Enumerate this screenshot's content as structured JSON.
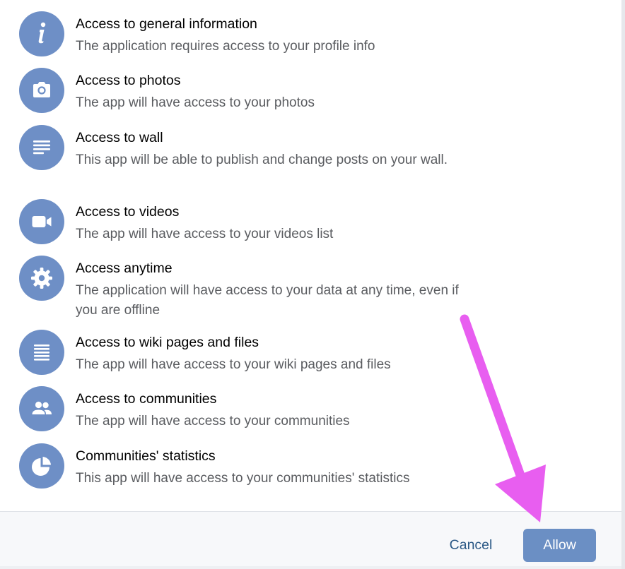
{
  "permissions": [
    {
      "icon": "info-icon",
      "title": "Access to general information",
      "description": "The application requires access to your profile info"
    },
    {
      "icon": "camera-icon",
      "title": "Access to photos",
      "description": "The app will have access to your photos"
    },
    {
      "icon": "wall-icon",
      "title": "Access to wall",
      "description": "This app will be able to publish and change posts on your wall."
    },
    {
      "icon": "video-camera-icon",
      "title": "Access to videos",
      "description": "The app will have access to your videos list"
    },
    {
      "icon": "gear-icon",
      "title": "Access anytime",
      "description": "The application will have access to your data at any time, even if you are offline"
    },
    {
      "icon": "document-icon",
      "title": "Access to wiki pages and files",
      "description": "The app will have access to your wiki pages and files"
    },
    {
      "icon": "users-icon",
      "title": "Access to communities",
      "description": "The app will have access to your communities"
    },
    {
      "icon": "pie-chart-icon",
      "title": "Communities' statistics",
      "description": "This app will have access to your communities' statistics"
    }
  ],
  "footer": {
    "cancel_label": "Cancel",
    "allow_label": "Allow"
  },
  "colors": {
    "icon_background": "#6e8fc6",
    "allow_button": "#6b8fc4",
    "cancel_text": "#2a5885",
    "annotation_arrow": "#e85ef0"
  }
}
